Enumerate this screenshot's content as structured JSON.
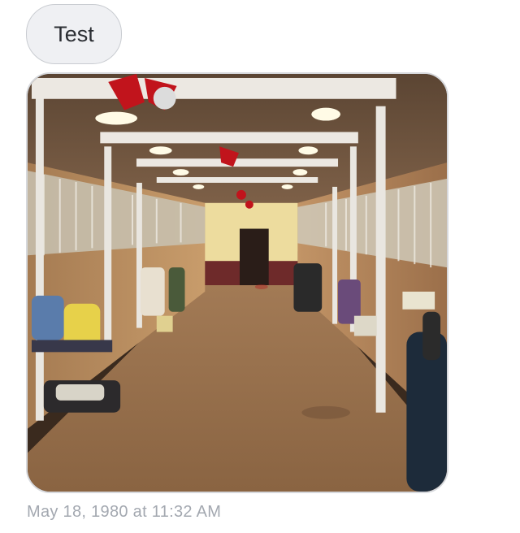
{
  "message": {
    "text": "Test"
  },
  "attachment": {
    "type": "photo",
    "subject": "stable-aisle-image"
  },
  "timestamp": "May 18, 1980 at 11:32 AM",
  "colors": {
    "bubble_bg": "#eff0f3",
    "bubble_border": "#c9ccd1",
    "timestamp_text": "#a3a8b0"
  }
}
